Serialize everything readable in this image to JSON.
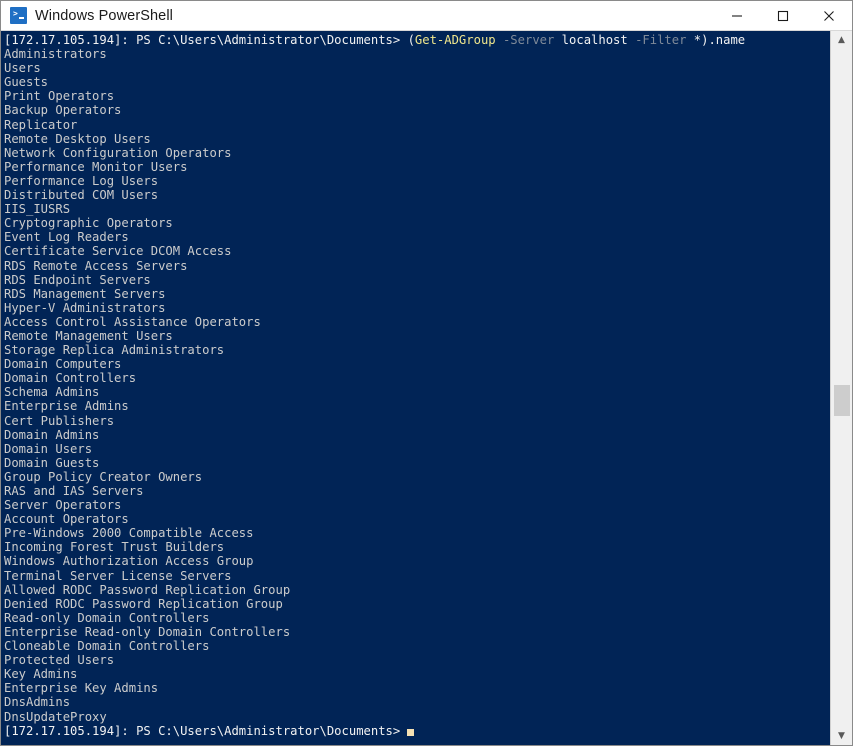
{
  "window": {
    "title": "Windows PowerShell",
    "icon": "powershell-prompt-icon",
    "background_color": "#012456",
    "titlebar_color": "#ffffff",
    "controls": {
      "minimize_label": "─",
      "maximize_label": "□",
      "close_label": "✕"
    }
  },
  "terminal": {
    "foreground_color": "#cccccc",
    "prompt_color": "#f2f2f2",
    "cmdlet_color": "#f0e68c",
    "parameter_color": "#7f8a99",
    "prompt_prefix": "[172.17.105.194]: PS C:\\Users\\Administrator\\Documents> ",
    "command": {
      "full_text": "(Get-ADGroup -Server localhost -Filter *).name",
      "tokens": [
        {
          "text": "(",
          "color": "white"
        },
        {
          "text": "Get-ADGroup",
          "color": "yellow"
        },
        {
          "text": " ",
          "color": "white"
        },
        {
          "text": "-Server",
          "color": "grey"
        },
        {
          "text": " localhost ",
          "color": "white"
        },
        {
          "text": "-Filter",
          "color": "grey"
        },
        {
          "text": " *).name",
          "color": "white"
        }
      ]
    },
    "output_lines": [
      "Administrators",
      "Users",
      "Guests",
      "Print Operators",
      "Backup Operators",
      "Replicator",
      "Remote Desktop Users",
      "Network Configuration Operators",
      "Performance Monitor Users",
      "Performance Log Users",
      "Distributed COM Users",
      "IIS_IUSRS",
      "Cryptographic Operators",
      "Event Log Readers",
      "Certificate Service DCOM Access",
      "RDS Remote Access Servers",
      "RDS Endpoint Servers",
      "RDS Management Servers",
      "Hyper-V Administrators",
      "Access Control Assistance Operators",
      "Remote Management Users",
      "Storage Replica Administrators",
      "Domain Computers",
      "Domain Controllers",
      "Schema Admins",
      "Enterprise Admins",
      "Cert Publishers",
      "Domain Admins",
      "Domain Users",
      "Domain Guests",
      "Group Policy Creator Owners",
      "RAS and IAS Servers",
      "Server Operators",
      "Account Operators",
      "Pre-Windows 2000 Compatible Access",
      "Incoming Forest Trust Builders",
      "Windows Authorization Access Group",
      "Terminal Server License Servers",
      "Allowed RODC Password Replication Group",
      "Denied RODC Password Replication Group",
      "Read-only Domain Controllers",
      "Enterprise Read-only Domain Controllers",
      "Cloneable Domain Controllers",
      "Protected Users",
      "Key Admins",
      "Enterprise Key Admins",
      "DnsAdmins",
      "DnsUpdateProxy"
    ],
    "final_prompt": "[172.17.105.194]: PS C:\\Users\\Administrator\\Documents>",
    "cursor_visible": true
  },
  "scrollbar": {
    "up_arrow": "▲",
    "down_arrow": "▼",
    "thumb_position_percent": 52
  }
}
